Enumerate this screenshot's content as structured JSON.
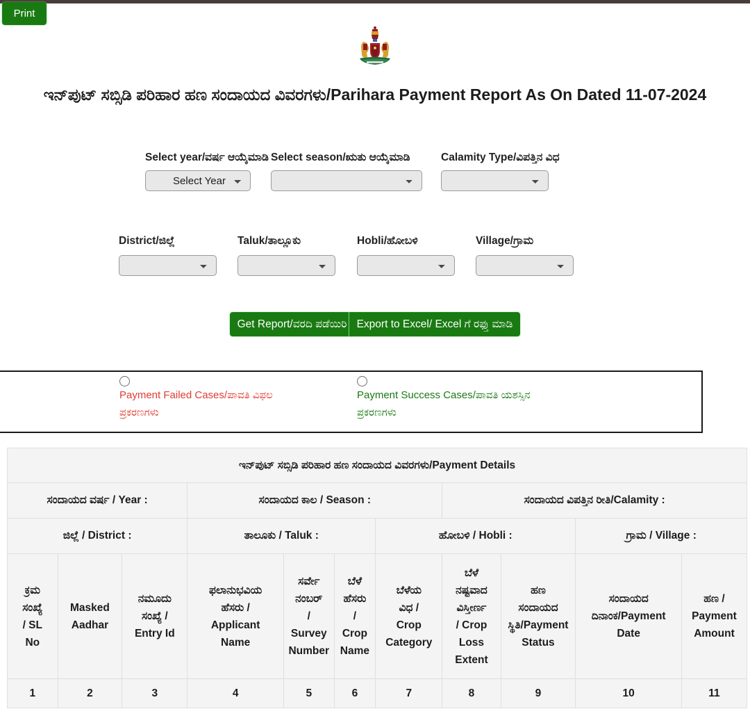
{
  "theme": {
    "top_bar_color": "#473d38",
    "button_green": "#1a7a12",
    "fail_red": "#e03c31",
    "success_green": "#1a7a12",
    "table_cell_bg": "#f4f4f4"
  },
  "toolbar": {
    "print_label": "Print"
  },
  "header": {
    "emblem_name": "karnataka-state-emblem",
    "title": "ಇನ್‌ಪುಟ್ ಸಬ್ಸಿಡಿ ಪರಿಹಾರ ಹಣ ಸಂದಾಯದ ವಿವರಗಳು/Parihara Payment Report As On Dated 11-07-2024",
    "as_on_date": "11-07-2024"
  },
  "form": {
    "year": {
      "label": "Select year/ವರ್ಷ ಆಯ್ಕೆಮಾಡಿ",
      "value": "Select Year",
      "options": [
        "Select Year"
      ]
    },
    "season": {
      "label": "Select season/ಋತು ಆಯ್ಕೆಮಾಡಿ",
      "value": "",
      "options": [
        ""
      ]
    },
    "calamity": {
      "label": "Calamity Type/ವಿಪತ್ತಿನ ವಿಧ",
      "value": "",
      "options": [
        ""
      ]
    },
    "district": {
      "label": "District/ಜಿಲ್ಲೆ",
      "value": "",
      "options": [
        ""
      ]
    },
    "taluk": {
      "label": "Taluk/ತಾಲ್ಲೂಕು",
      "value": "",
      "options": [
        ""
      ]
    },
    "hobli": {
      "label": "Hobli/ಹೋಬಳಿ",
      "value": "",
      "options": [
        ""
      ]
    },
    "village": {
      "label": "Village/ಗ್ರಾಮ",
      "value": "",
      "options": [
        ""
      ]
    },
    "get_report_label": "Get Report/ವರದಿ ಪಡೆಯಿರಿ",
    "export_excel_label": "Export to Excel/ Excel ಗೆ ರಫ್ತು ಮಾಡಿ"
  },
  "filters": {
    "payment_failed_label": "Payment Failed Cases/ಪಾವತಿ ವಿಫಲ\nಪ್ರಕರಣಗಳು",
    "payment_success_label": "Payment Success Cases/ಪಾವತಿ ಯಶಸ್ಸಿನ\nಪ್ರಕರಣಗಳು"
  },
  "table": {
    "title": "ಇನ್‌ಪುಟ್ ಸಬ್ಸಿಡಿ ಪರಿಹಾರ ಹಣ ಸಂದಾಯದ ವಿವರಗಳು/Payment Details",
    "meta_row_1": [
      "ಸಂದಾಯದ ವರ್ಷ / Year :",
      "ಸಂದಾಯದ ಕಾಲ / Season :",
      "ಸಂದಾಯದ ವಿಪತ್ತಿನ ರೀತಿ/Calamity :"
    ],
    "meta_row_2": [
      "ಜಿಲ್ಲೆ / District :",
      "ತಾಲೂಕು / Taluk :",
      "ಹೋಬಳಿ / Hobli :",
      "ಗ್ರಾಮ / Village :"
    ],
    "columns": [
      "ಕ್ರಮ\nಸಂಖ್ಯೆ\n/ SL\nNo",
      "Masked\nAadhar",
      "ನಮೂದು\nಸಂಖ್ಯೆ /\nEntry Id",
      "ಫಲಾನುಭವಿಯ\nಹೆಸರು /\nApplicant\nName",
      "ಸರ್ವೇ\nನಂಬರ್\n/\nSurvey\nNumber",
      "ಬೆಳೆ\nಹೆಸರು\n/\nCrop\nName",
      "ಬೆಳೆಯ\nವಿಧ /\nCrop\nCategory",
      "ಬೆಳೆ\nನಷ್ಟವಾದ\nವಿಸ್ತೀರ್ಣ\n/ Crop\nLoss\nExtent",
      "ಹಣ\nಸಂದಾಯದ\nಸ್ಥಿತಿ/Payment\nStatus",
      "ಸಂದಾಯದ\nದಿನಾಂಕ/Payment\nDate",
      "ಹಣ /\nPayment\nAmount"
    ],
    "column_numbers": [
      "1",
      "2",
      "3",
      "4",
      "5",
      "6",
      "7",
      "8",
      "9",
      "10",
      "11"
    ]
  }
}
